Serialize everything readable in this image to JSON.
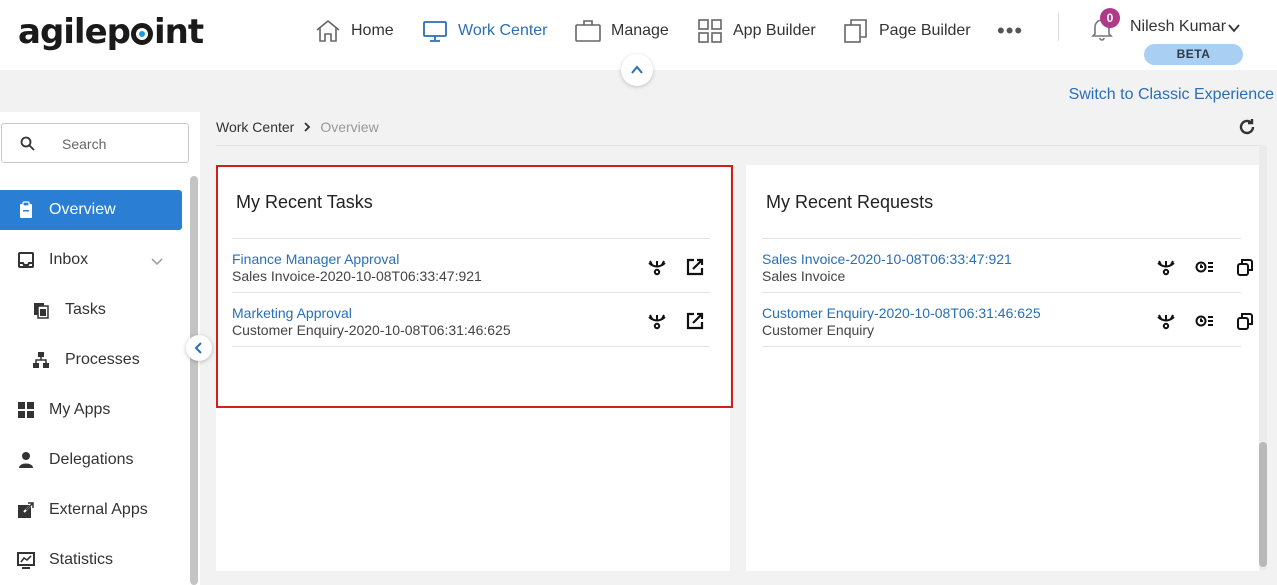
{
  "brand": {
    "logo_left": "agilep",
    "logo_right": "int"
  },
  "nav": {
    "home": "Home",
    "work_center": "Work Center",
    "manage": "Manage",
    "app_builder": "App Builder",
    "page_builder": "Page Builder",
    "more": "•••"
  },
  "notifications": {
    "count": "0"
  },
  "user": {
    "name": "Nilesh Kumar",
    "badge": "BETA"
  },
  "switch_link": "Switch to Classic Experience",
  "sidebar": {
    "search_placeholder": "Search",
    "items": [
      {
        "label": "Overview"
      },
      {
        "label": "Inbox"
      },
      {
        "label": "Tasks"
      },
      {
        "label": "Processes"
      },
      {
        "label": "My Apps"
      },
      {
        "label": "Delegations"
      },
      {
        "label": "External Apps"
      },
      {
        "label": "Statistics"
      }
    ]
  },
  "breadcrumb": {
    "root": "Work Center",
    "current": "Overview"
  },
  "tasks_card": {
    "title": "My Recent Tasks",
    "rows": [
      {
        "title": "Finance Manager Approval",
        "subtitle": "Sales Invoice-2020-10-08T06:33:47:921"
      },
      {
        "title": "Marketing Approval",
        "subtitle": "Customer Enquiry-2020-10-08T06:31:46:625"
      }
    ]
  },
  "requests_card": {
    "title": "My Recent Requests",
    "rows": [
      {
        "title": "Sales Invoice-2020-10-08T06:33:47:921",
        "subtitle": "Sales Invoice"
      },
      {
        "title": "Customer Enquiry-2020-10-08T06:31:46:625",
        "subtitle": "Customer Enquiry"
      }
    ]
  },
  "colors": {
    "accent": "#2a7fd4",
    "link": "#2a6fb5",
    "highlight": "#d01f1f",
    "badge": "#b03a8a",
    "beta": "#a9cff2"
  }
}
